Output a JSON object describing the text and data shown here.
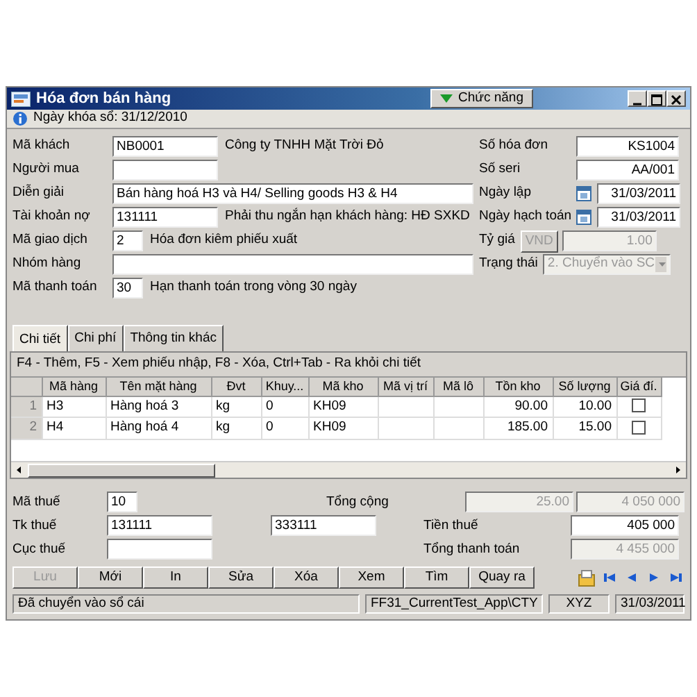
{
  "window": {
    "title": "Hóa đơn bán hàng",
    "menu_button": "Chức năng"
  },
  "info": "Ngày khóa sổ: 31/12/2010",
  "left_fields": [
    {
      "label": "Mã khách",
      "kind": "medium",
      "value": "NB0001",
      "note": "Công ty TNHH  Mặt Trời Đỏ"
    },
    {
      "label": "Người mua",
      "kind": "medium"
    },
    {
      "label": "Diễn giải",
      "kind": "wide",
      "value": "Bán hàng hoá H3 và H4/ Selling goods H3 & H4"
    },
    {
      "label": "Tài khoản nợ",
      "kind": "medium",
      "value": "131111",
      "note": "Phải thu ngắn hạn khách hàng: HĐ SXKD"
    },
    {
      "label": "Mã giao dịch",
      "kind": "tiny",
      "value": "2",
      "note": "Hóa đơn kiêm phiếu xuất"
    },
    {
      "label": "Nhóm hàng",
      "kind": "wide"
    },
    {
      "label": "Mã thanh toán",
      "kind": "tiny",
      "value": "30",
      "note": "Hạn thanh toán trong vòng 30 ngày"
    }
  ],
  "right_fields": [
    {
      "label": "Số hóa đơn",
      "kind": "text",
      "value": "KS1004"
    },
    {
      "label": "Số seri",
      "kind": "text",
      "value": "AA/001"
    },
    {
      "label": "Ngày lập",
      "kind": "date",
      "value": "31/03/2011"
    },
    {
      "label": "Ngày hạch toán",
      "kind": "date",
      "value": "31/03/2011"
    },
    {
      "label": "Tỷ giá",
      "kind": "currency",
      "button": "VND",
      "value": "1.00",
      "disabled": true
    },
    {
      "label": "Trạng thái",
      "kind": "select",
      "value": "2. Chuyển vào SC",
      "disabled": true
    }
  ],
  "tabs": [
    {
      "label": "Chi tiết",
      "selected": true
    },
    {
      "label": "Chi phí",
      "selected": false
    },
    {
      "label": "Thông tin khác",
      "selected": false
    }
  ],
  "grid": {
    "hint": "F4 - Thêm, F5 - Xem phiếu nhập, F8 - Xóa, Ctrl+Tab - Ra khỏi chi tiết",
    "columns": [
      "Mã hàng",
      "Tên mặt hàng",
      "Đvt",
      "Khuy...",
      "Mã kho",
      "Mã vị trí",
      "Mã lô",
      "Tồn kho",
      "Số lượng",
      "Giá đí."
    ],
    "rows": [
      {
        "number": "1",
        "cells": [
          "H3",
          "Hàng hoá 3",
          "kg",
          "0",
          "KH09",
          "",
          "",
          "90.00",
          "10.00"
        ],
        "checked": false
      },
      {
        "number": "2",
        "cells": [
          "H4",
          "Hàng hoá 4",
          "kg",
          "0",
          "KH09",
          "",
          "",
          "185.00",
          "15.00"
        ],
        "checked": false
      }
    ]
  },
  "totals": {
    "tax_code": {
      "label": "Mã thuế",
      "value": "10"
    },
    "tax_accounts": {
      "label": "Tk thuế",
      "values": [
        "131111",
        "333111"
      ]
    },
    "tax_office": {
      "label": "Cục thuế"
    },
    "total": {
      "label": "Tổng cộng",
      "values": [
        "25.00",
        "4 050 000"
      ],
      "disabled": true
    },
    "tax": {
      "label": "Tiền thuế",
      "value": "405 000",
      "disabled": false
    },
    "grand_total": {
      "label": "Tổng thanh toán",
      "value": "4 455 000",
      "disabled": true
    }
  },
  "buttons": [
    {
      "label": "Lưu",
      "disabled": true
    },
    {
      "label": "Mới",
      "disabled": false
    },
    {
      "label": "In",
      "disabled": false
    },
    {
      "label": "Sửa",
      "disabled": false
    },
    {
      "label": "Xóa",
      "disabled": false
    },
    {
      "label": "Xem",
      "disabled": false
    },
    {
      "label": "Tìm",
      "disabled": false
    },
    {
      "label": "Quay ra",
      "disabled": false
    }
  ],
  "status_bar": [
    "Đã chuyển vào sổ cái",
    "FF31_CurrentTest_App\\CTY",
    "XYZ",
    "31/03/2011"
  ]
}
